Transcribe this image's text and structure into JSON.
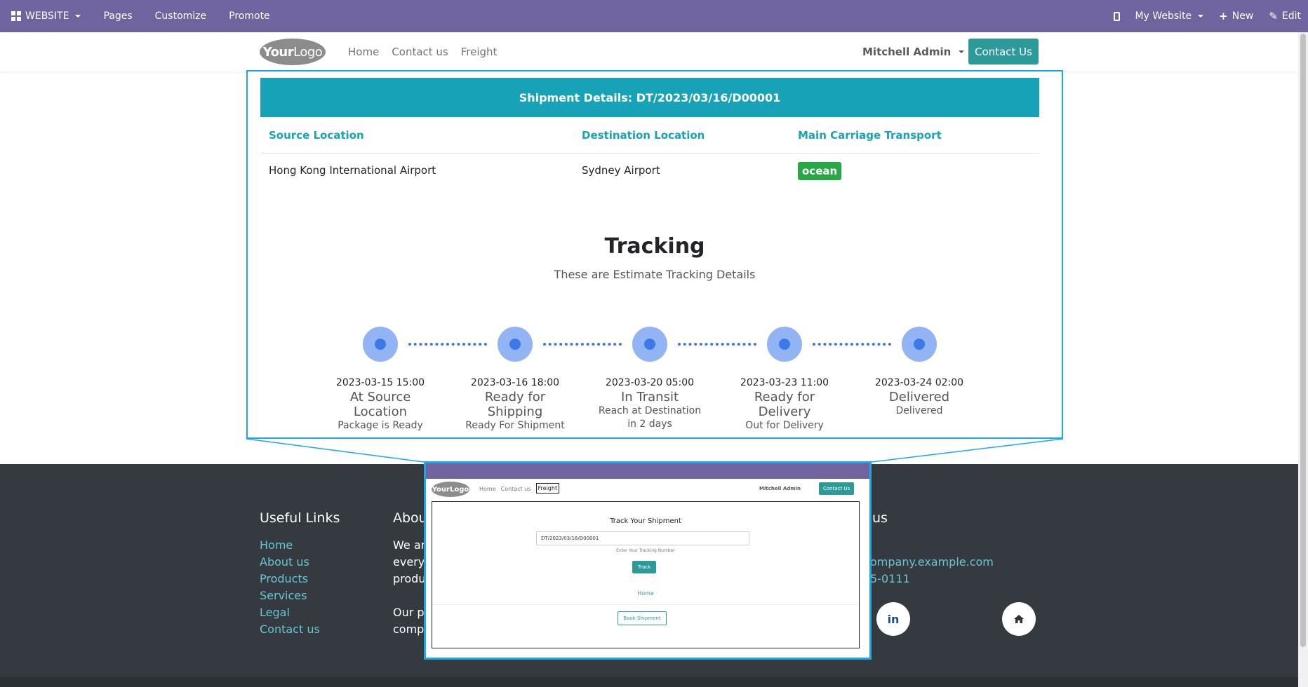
{
  "adminbar": {
    "website_label": "WEBSITE",
    "pages_label": "Pages",
    "customize_label": "Customize",
    "promote_label": "Promote",
    "my_website_label": "My Website",
    "new_label": "New",
    "edit_label": "Edit"
  },
  "header": {
    "logo_bold": "Your",
    "logo_thin": "Logo",
    "nav": [
      "Home",
      "Contact us",
      "Freight"
    ],
    "user": "Mitchell Admin",
    "contact_button": "Contact Us"
  },
  "shipment": {
    "title": "Shipment Details: DT/2023/03/16/D00001",
    "columns": [
      "Source Location",
      "Destination Location",
      "Main Carriage Transport"
    ],
    "source": "Hong Kong International Airport",
    "destination": "Sydney Airport",
    "transport": "ocean"
  },
  "tracking": {
    "title": "Tracking",
    "subtitle": "These are Estimate Tracking Details",
    "steps": [
      {
        "date": "2023-03-15 15:00",
        "status": "At Source Location",
        "desc": "Package is Ready"
      },
      {
        "date": "2023-03-16 18:00",
        "status": "Ready for Shipping",
        "desc": "Ready For Shipment"
      },
      {
        "date": "2023-03-20 05:00",
        "status": "In Transit",
        "desc": "Reach at Destination in 2 days"
      },
      {
        "date": "2023-03-23 11:00",
        "status": "Ready for Delivery",
        "desc": "Out for Delivery"
      },
      {
        "date": "2023-03-24 02:00",
        "status": "Delivered",
        "desc": "Delivered"
      }
    ]
  },
  "footer": {
    "useful_links_title": "Useful Links",
    "links": [
      "Home",
      "About us",
      "Products",
      "Services",
      "Legal",
      "Contact us"
    ],
    "about_title": "Abou",
    "about_lines": [
      "We are",
      "everyc",
      "produc",
      "Our pr",
      "compa"
    ],
    "connect_title": "us",
    "email": "ompany.example.com",
    "phone": "5-0111",
    "linkedin": "in"
  },
  "inset": {
    "logo": "YourLogo",
    "nav": [
      "Home",
      "Contact us",
      "Freight"
    ],
    "user": "Mitchell Admin",
    "contact_button": "Contact Us",
    "track_title": "Track Your Shipment",
    "tracking_value": "DT/2023/03/16/D00001",
    "hint": "Enter Your Tracking Number",
    "track_button": "Track",
    "home_link": "Home",
    "book_button": "Book Shipment"
  }
}
